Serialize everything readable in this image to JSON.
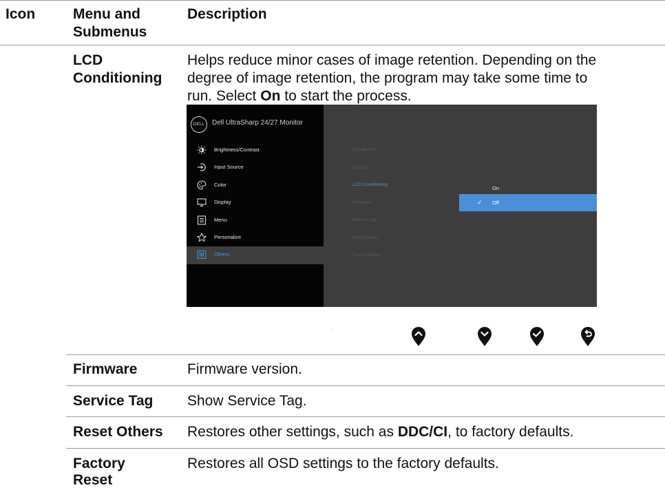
{
  "table_header": {
    "icon": "Icon",
    "menu_line1": "Menu and",
    "menu_line2": "Submenus",
    "description": "Description"
  },
  "lcd_conditioning": {
    "label_line1": "LCD",
    "label_line2": "Conditioning",
    "desc_line1": "Helps reduce minor cases of image retention. Depending on the",
    "desc_line2": "degree of image retention, the program may take some time to",
    "desc_line3_prefix": "run. Select ",
    "desc_line3_bold": "On",
    "desc_line3_suffix": " to start the process."
  },
  "osd": {
    "logo": "DELL",
    "title": "Dell UltraSharp 24/27 Monitor",
    "main_menu": [
      {
        "label": "Brightness/Contrast",
        "icon": "brightness-icon"
      },
      {
        "label": "Input Source",
        "icon": "input-source-icon"
      },
      {
        "label": "Color",
        "icon": "color-palette-icon"
      },
      {
        "label": "Display",
        "icon": "display-monitor-icon"
      },
      {
        "label": "Menu",
        "icon": "menu-list-icon"
      },
      {
        "label": "Personalize",
        "icon": "star-icon"
      },
      {
        "label": "Others",
        "icon": "others-sliders-icon",
        "selected": true
      }
    ],
    "sub_menu": [
      "Display Info",
      "DDC/CI",
      "LCD Conditioning",
      "Firmware",
      "Service Tag",
      "Reset Others",
      "Factory Reset"
    ],
    "sub_menu_selected": "LCD Conditioning",
    "options": {
      "on": "On",
      "off": "Off",
      "selected": "Off"
    },
    "accent_color": "#4a90d9"
  },
  "buttons": [
    {
      "icon": "up-arrow-icon"
    },
    {
      "icon": "down-arrow-icon"
    },
    {
      "icon": "check-icon"
    },
    {
      "icon": "back-icon"
    }
  ],
  "rows": [
    {
      "label_line1": "Firmware",
      "label_line2": "",
      "desc": "Firmware version."
    },
    {
      "label_line1": "Service Tag",
      "label_line2": "",
      "desc": "Show Service Tag."
    },
    {
      "label_line1": "Reset Others",
      "label_line2": "",
      "desc_prefix": "Restores other settings, such as ",
      "desc_bold": "DDC/CI",
      "desc_suffix": ", to factory defaults."
    },
    {
      "label_line1": "Factory",
      "label_line2": "Reset",
      "desc": "Restores all OSD settings to the factory defaults."
    }
  ]
}
